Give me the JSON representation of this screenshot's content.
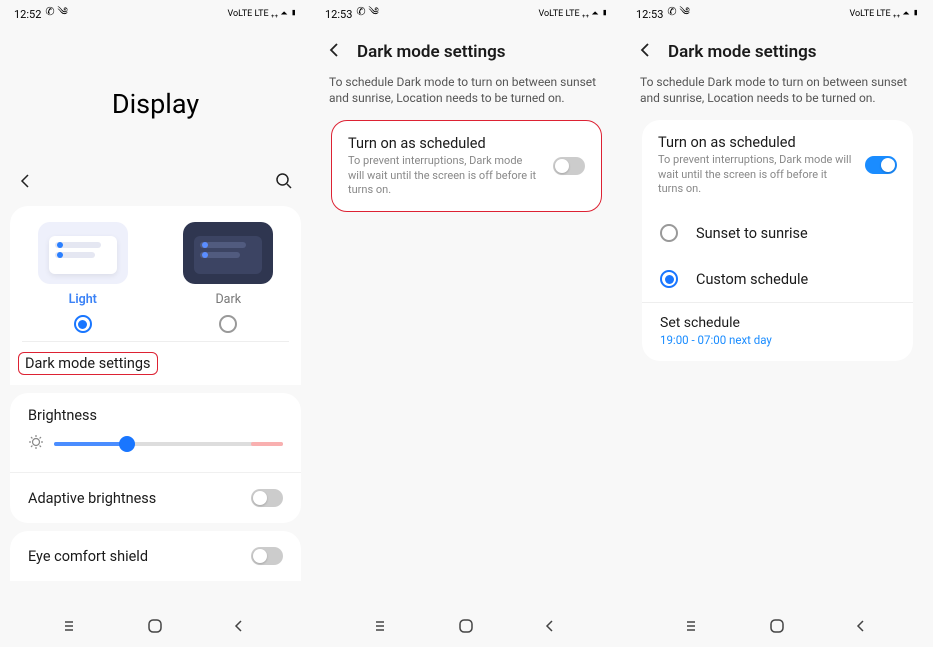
{
  "screen1": {
    "status_time": "12:52",
    "status_left_icons": "✆ ༄",
    "status_right": "VoLTE LTE ₊₊ ⏶ ▮",
    "title": "Display",
    "theme_light": "Light",
    "theme_dark": "Dark",
    "dark_mode_settings": "Dark mode settings",
    "brightness_label": "Brightness",
    "adaptive_label": "Adaptive brightness",
    "eye_label": "Eye comfort shield"
  },
  "screen2": {
    "status_time": "12:53",
    "status_left_icons": "✆ ༄",
    "status_right": "VoLTE LTE ₊₊ ⏶ ▮",
    "title": "Dark mode settings",
    "helper": "To schedule Dark mode to turn on between sunset and sunrise, Location needs to be turned on.",
    "sched_title": "Turn on as scheduled",
    "sched_sub": "To prevent interruptions, Dark mode will wait until the screen is off before it turns on."
  },
  "screen3": {
    "status_time": "12:53",
    "status_left_icons": "✆ ༄",
    "status_right": "VoLTE LTE ₊₊ ⏶ ▮",
    "title": "Dark mode settings",
    "helper": "To schedule Dark mode to turn on between sunset and sunrise, Location needs to be turned on.",
    "sched_title": "Turn on as scheduled",
    "sched_sub": "To prevent interruptions, Dark mode will wait until the screen is off before it turns on.",
    "opt_sunset": "Sunset to sunrise",
    "opt_custom": "Custom schedule",
    "set_label": "Set schedule",
    "set_value": "19:00 - 07:00 next day"
  }
}
